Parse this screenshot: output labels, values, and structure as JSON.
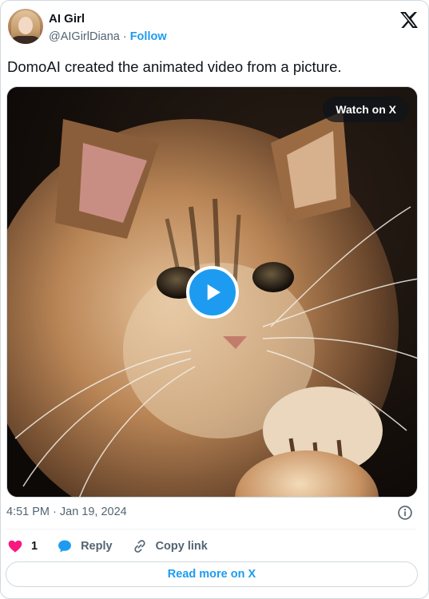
{
  "author": {
    "name": "AI Girl",
    "handle": "@AIGirlDiana",
    "separator": "·",
    "follow_label": "Follow"
  },
  "logo_icon": "x-logo-icon",
  "tweet": {
    "text": "DomoAI created the animated video from a picture."
  },
  "media": {
    "watch_label": "Watch on X",
    "play_icon": "play-icon"
  },
  "meta": {
    "timestamp": "4:51 PM · Jan 19, 2024",
    "info_icon": "info-icon"
  },
  "actions": {
    "likes_count": "1",
    "reply_label": "Reply",
    "copy_label": "Copy link"
  },
  "read_more_label": "Read more on X",
  "colors": {
    "brand_blue": "#1d9bf0",
    "like_pink": "#f91880",
    "text_primary": "#0f1419",
    "text_secondary": "#536471",
    "border": "#cfd9de"
  }
}
